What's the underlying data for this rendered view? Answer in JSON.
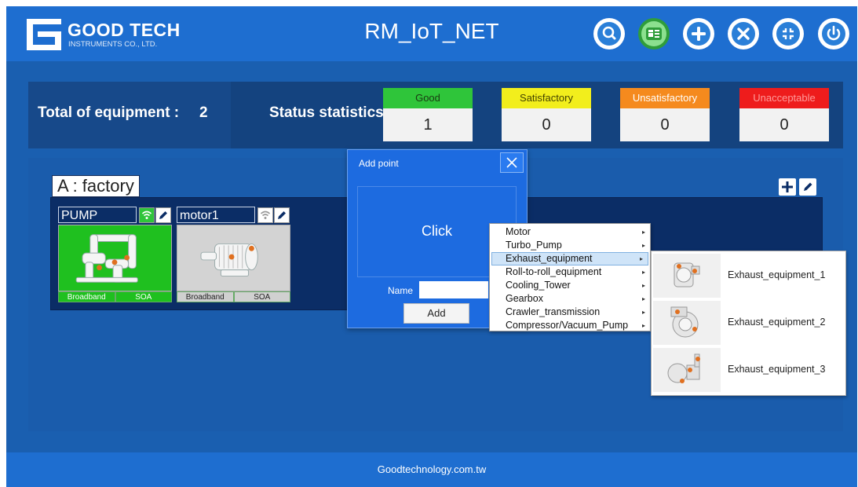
{
  "header": {
    "logo_name": "GOOD TECH",
    "logo_sub": "INSTRUMENTS CO., LTD.",
    "title": "RM_IoT_NET",
    "buttons": [
      {
        "name": "search",
        "icon": "search-icon"
      },
      {
        "name": "contacts",
        "icon": "contact-card-icon",
        "active": true
      },
      {
        "name": "add",
        "icon": "plus-icon"
      },
      {
        "name": "tools",
        "icon": "tools-icon"
      },
      {
        "name": "collapse",
        "icon": "collapse-icon"
      },
      {
        "name": "power",
        "icon": "power-icon"
      }
    ]
  },
  "stats": {
    "total_label": "Total of equipment :",
    "total_value": "2",
    "status_label": "Status statistics",
    "items": [
      {
        "label": "Good",
        "value": "1",
        "head_bg": "#2fc53a",
        "head_fg": "#1a3a12"
      },
      {
        "label": "Satisfactory",
        "value": "0",
        "head_bg": "#f2ee1c",
        "head_fg": "#444400"
      },
      {
        "label": "Unsatisfactory",
        "value": "0",
        "head_bg": "#f58a1e",
        "head_fg": "#ffffff"
      },
      {
        "label": "Unacceptable",
        "value": "0",
        "head_bg": "#ee1c1c",
        "head_fg": "#ff9a9a"
      }
    ]
  },
  "factory": {
    "label": "A : factory",
    "cards": [
      {
        "name": "PUMP",
        "status": "good",
        "image_bg": "#1fc01f",
        "foot_bg": "#1fc01f",
        "foot_fg": "#ffffff",
        "wifi_bg": "#2fc53a",
        "footer": [
          "Broadband",
          "SOA"
        ]
      },
      {
        "name": "motor1",
        "status": "none",
        "image_bg": "#d3d3d3",
        "foot_bg": "#d0d0d0",
        "foot_fg": "#222222",
        "wifi_bg": "#ffffff",
        "footer": [
          "Broadband",
          "SOA"
        ]
      }
    ]
  },
  "dialog": {
    "title": "Add point",
    "click_text": "Click",
    "name_label": "Name",
    "name_value": "",
    "add_label": "Add"
  },
  "menu": {
    "items": [
      {
        "label": "Motor",
        "selected": false
      },
      {
        "label": "Turbo_Pump",
        "selected": false
      },
      {
        "label": "Exhaust_equipment",
        "selected": true
      },
      {
        "label": "Roll-to-roll_equipment",
        "selected": false
      },
      {
        "label": "Cooling_Tower",
        "selected": false
      },
      {
        "label": "Gearbox",
        "selected": false
      },
      {
        "label": "Crawler_transmission",
        "selected": false
      },
      {
        "label": "Compressor/Vacuum_Pump",
        "selected": false
      }
    ],
    "arrow": "▸"
  },
  "submenu": {
    "items": [
      {
        "label": "Exhaust_equipment_1"
      },
      {
        "label": "Exhaust_equipment_2"
      },
      {
        "label": "Exhaust_equipment_3"
      }
    ]
  },
  "footer": {
    "text": "Goodtechnology.com.tw"
  }
}
